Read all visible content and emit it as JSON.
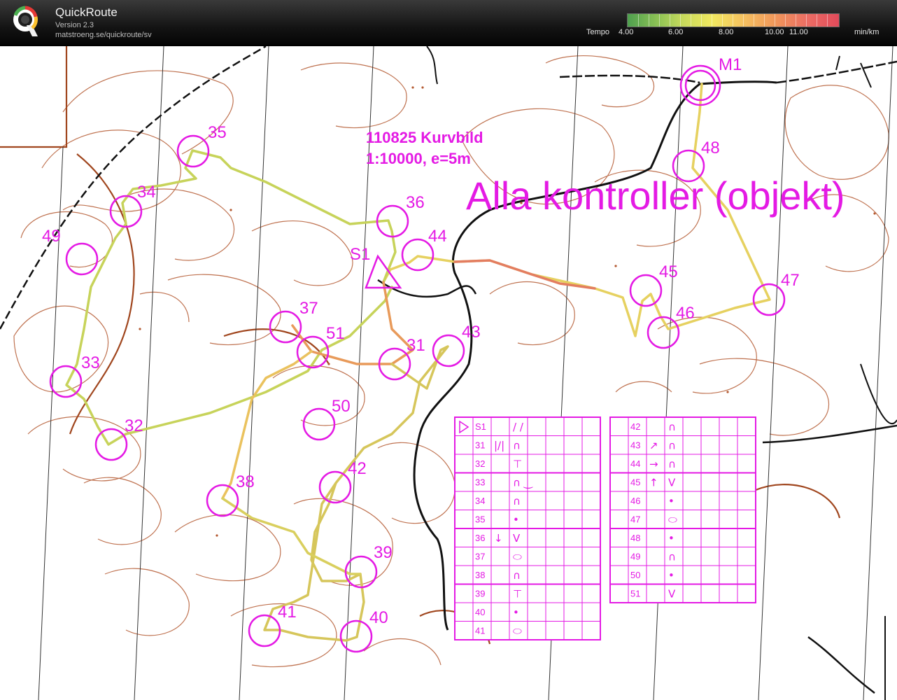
{
  "app": {
    "name": "QuickRoute",
    "version": "Version 2.3",
    "url": "matstroeng.se/quickroute/sv"
  },
  "tempo": {
    "title": "Tempo",
    "ticks": [
      "4.00",
      "6.00",
      "8.00",
      "10.00",
      "11.00"
    ],
    "unit": "min/km",
    "gradient_colors": [
      "#4fa04f",
      "#c6d95c",
      "#f0e860",
      "#f0965a",
      "#e14a5a"
    ]
  },
  "map": {
    "course_title": "110825 Kurvbild",
    "course_scale": "1:10000, e=5m",
    "course_subtitle": "Alla kontroller (objekt)",
    "start_label": "S1",
    "finish_label": "M1",
    "overprint_color": "#e41ae4",
    "contour_color": "#b45a32",
    "controls": [
      {
        "label": "35"
      },
      {
        "label": "34"
      },
      {
        "label": "49"
      },
      {
        "label": "33"
      },
      {
        "label": "32"
      },
      {
        "label": "36"
      },
      {
        "label": "44"
      },
      {
        "label": "37"
      },
      {
        "label": "51"
      },
      {
        "label": "31"
      },
      {
        "label": "43"
      },
      {
        "label": "50"
      },
      {
        "label": "42"
      },
      {
        "label": "38"
      },
      {
        "label": "39"
      },
      {
        "label": "41"
      },
      {
        "label": "40"
      },
      {
        "label": "45"
      },
      {
        "label": "46"
      },
      {
        "label": "47"
      },
      {
        "label": "48"
      }
    ]
  },
  "descriptions": {
    "left_table": [
      {
        "code": "S1",
        "dir": "",
        "feature": "/ /"
      },
      {
        "code": "31",
        "dir": "|/|",
        "feature": "∩"
      },
      {
        "code": "32",
        "dir": "",
        "feature": "⊤"
      },
      {
        "code": "33",
        "dir": "",
        "feature": "∩ ‿"
      },
      {
        "code": "34",
        "dir": "",
        "feature": "∩"
      },
      {
        "code": "35",
        "dir": "",
        "feature": "•"
      },
      {
        "code": "36",
        "dir": "↓",
        "feature": "V"
      },
      {
        "code": "37",
        "dir": "",
        "feature": "⬭"
      },
      {
        "code": "38",
        "dir": "",
        "feature": "∩"
      },
      {
        "code": "39",
        "dir": "",
        "feature": "⊤"
      },
      {
        "code": "40",
        "dir": "",
        "feature": "•"
      },
      {
        "code": "41",
        "dir": "",
        "feature": "⬭"
      }
    ],
    "right_table": [
      {
        "code": "42",
        "dir": "",
        "feature": "∩"
      },
      {
        "code": "43",
        "dir": "↗",
        "feature": "∩"
      },
      {
        "code": "44",
        "dir": "→",
        "feature": "∩"
      },
      {
        "code": "45",
        "dir": "↑",
        "feature": "V"
      },
      {
        "code": "46",
        "dir": "",
        "feature": "•"
      },
      {
        "code": "47",
        "dir": "",
        "feature": "⬭"
      },
      {
        "code": "48",
        "dir": "",
        "feature": "•"
      },
      {
        "code": "49",
        "dir": "",
        "feature": "∩"
      },
      {
        "code": "50",
        "dir": "",
        "feature": "•"
      },
      {
        "code": "51",
        "dir": "",
        "feature": "V"
      }
    ]
  }
}
